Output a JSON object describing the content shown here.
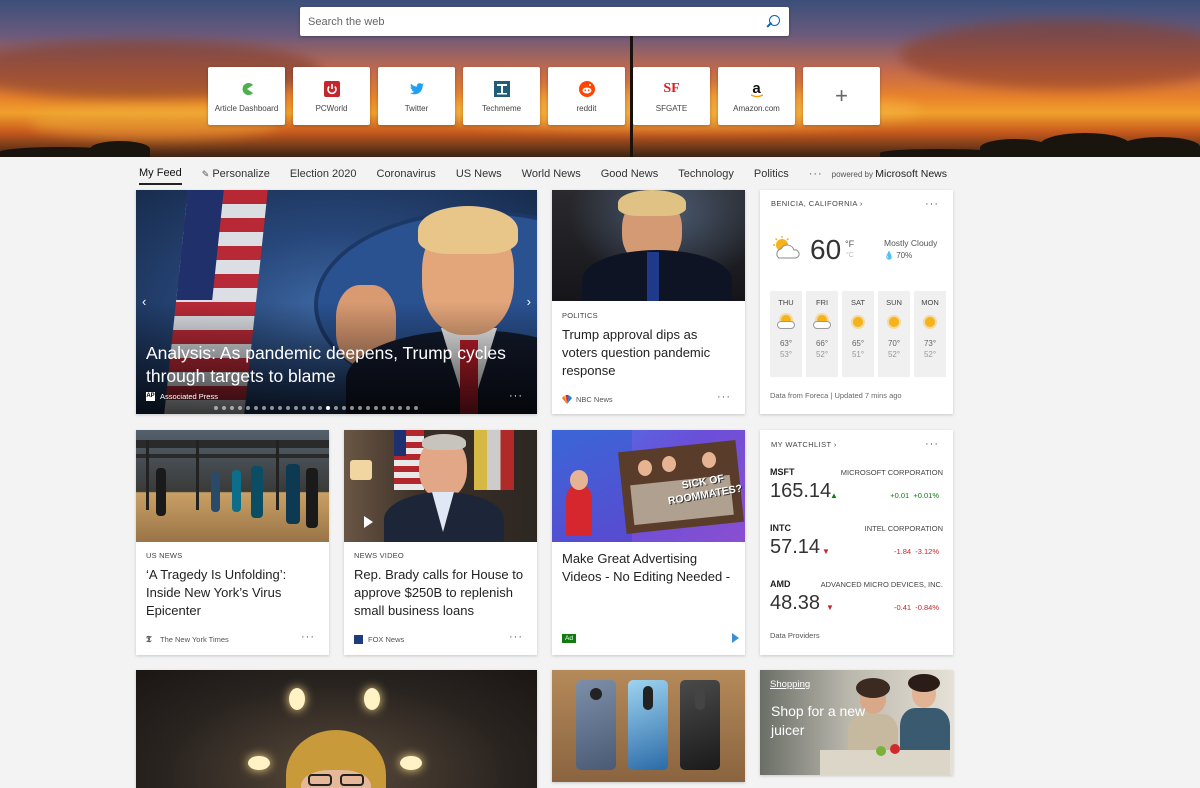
{
  "search": {
    "placeholder": "Search the web"
  },
  "quick_links": [
    {
      "label": "Article Dashboard",
      "icon": "pacman-icon",
      "color": "#4caf50"
    },
    {
      "label": "PCWorld",
      "icon": "power-icon",
      "color": "#c4262e"
    },
    {
      "label": "Twitter",
      "icon": "twitter-bird-icon",
      "color": "#1da1f2"
    },
    {
      "label": "Techmeme",
      "icon": "techmeme-t-icon",
      "color": "#1f5d7a"
    },
    {
      "label": "reddit",
      "icon": "reddit-icon",
      "color": "#ff4500"
    },
    {
      "label": "SFGATE",
      "icon": "sfgate-icon",
      "color": "#e31b23"
    },
    {
      "label": "Amazon.com",
      "icon": "amazon-icon",
      "color": "#111111"
    }
  ],
  "nav": {
    "items": [
      "My Feed",
      "Personalize",
      "Election 2020",
      "Coronavirus",
      "US News",
      "World News",
      "Good News",
      "Technology",
      "Politics"
    ],
    "more": "···",
    "powered_by_prefix": "powered by",
    "powered_by_brand": "Microsoft News"
  },
  "hero_story": {
    "headline": "Analysis: As pandemic deepens, Trump cycles through targets to blame",
    "source": "Associated Press",
    "source_logo": "AP",
    "slide_count": 26,
    "active_slide": 14
  },
  "story_politics": {
    "category": "POLITICS",
    "headline": "Trump approval dips as voters question pandemic response",
    "source": "NBC News"
  },
  "weather": {
    "location": "BENICIA, CALIFORNIA",
    "temp": "60",
    "unit_f": "°F",
    "unit_c": "°C",
    "condition": "Mostly Cloudy",
    "humidity": "70%",
    "forecast": [
      {
        "day": "THU",
        "hi": "63°",
        "lo": "53°",
        "icon": "partly-cloudy-icon"
      },
      {
        "day": "FRI",
        "hi": "66°",
        "lo": "52°",
        "icon": "partly-cloudy-icon"
      },
      {
        "day": "SAT",
        "hi": "65°",
        "lo": "51°",
        "icon": "sunny-icon"
      },
      {
        "day": "SUN",
        "hi": "70°",
        "lo": "52°",
        "icon": "sunny-icon"
      },
      {
        "day": "MON",
        "hi": "73°",
        "lo": "52°",
        "icon": "sunny-icon"
      }
    ],
    "footer": "Data from Foreca | Updated 7 mins ago"
  },
  "story_usnews": {
    "category": "US NEWS",
    "headline": "‘A Tragedy Is Unfolding’: Inside New York’s Virus Epicenter",
    "source": "The New York Times"
  },
  "story_video": {
    "category": "NEWS VIDEO",
    "headline": "Rep. Brady calls for House to approve $250B to replenish small business loans",
    "source": "FOX News"
  },
  "ad_card": {
    "headline": "Make Great Advertising Videos - No Editing Needed -",
    "badge": "Ad",
    "image_text": "SICK OF ROOMMATES?"
  },
  "watchlist": {
    "title": "MY WATCHLIST",
    "stocks": [
      {
        "symbol": "MSFT",
        "name": "MICROSOFT CORPORATION",
        "price": "165.14",
        "direction": "up",
        "change": "+0.01",
        "percent": "+0.01%"
      },
      {
        "symbol": "INTC",
        "name": "INTEL CORPORATION",
        "price": "57.14",
        "direction": "down",
        "change": "-1.84",
        "percent": "-3.12%"
      },
      {
        "symbol": "AMD",
        "name": "ADVANCED MICRO DEVICES, INC.",
        "price": "48.38",
        "direction": "down",
        "change": "-0.41",
        "percent": "-0.84%"
      }
    ],
    "footer": "Data Providers"
  },
  "shopping": {
    "tag": "Shopping",
    "text": "Shop for a new juicer"
  },
  "colors": {
    "accent": "#0067b8",
    "up": "#107c10",
    "down": "#c4262e"
  }
}
